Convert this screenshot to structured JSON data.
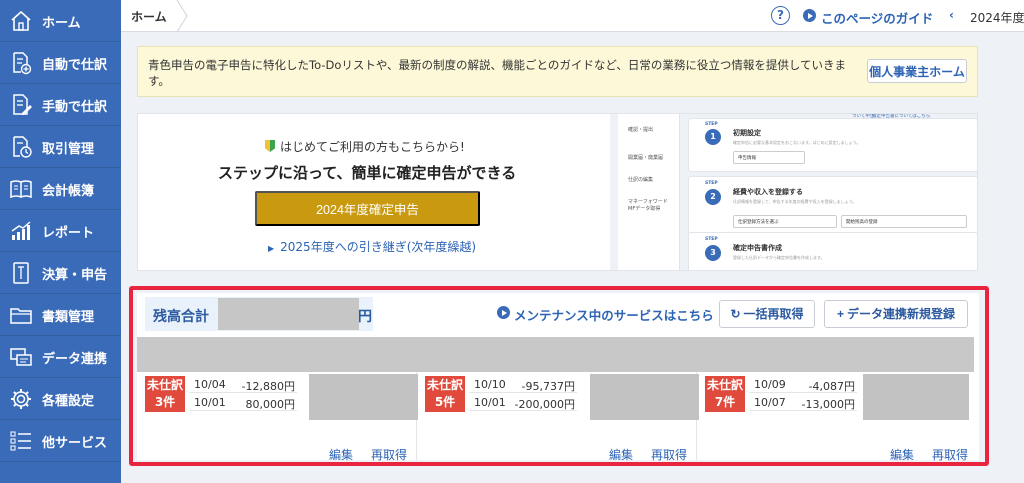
{
  "sidebar": {
    "items": [
      {
        "label": "ホーム",
        "icon": "home-icon"
      },
      {
        "label": "自動で仕訳",
        "icon": "auto-journal-icon"
      },
      {
        "label": "手動で仕訳",
        "icon": "manual-journal-icon"
      },
      {
        "label": "取引管理",
        "icon": "transaction-icon"
      },
      {
        "label": "会計帳簿",
        "icon": "ledger-icon"
      },
      {
        "label": "レポート",
        "icon": "report-icon"
      },
      {
        "label": "決算・申告",
        "icon": "tax-filing-icon"
      },
      {
        "label": "書類管理",
        "icon": "folder-icon"
      },
      {
        "label": "データ連携",
        "icon": "data-link-icon"
      },
      {
        "label": "各種設定",
        "icon": "gear-icon"
      },
      {
        "label": "他サービス",
        "icon": "list-icon"
      }
    ]
  },
  "topbar": {
    "breadcrumb": "ホーム",
    "help_label": "?",
    "guide_label": "このページのガイド",
    "year_prev": "‹",
    "year_label": "2024年度"
  },
  "notice": {
    "text": "青色申告の電子申告に特化したTo-Doリストや、最新の制度の解説、機能ごとのガイドなど、日常の業務に役立つ情報を提供していきます。",
    "button": "個人事業主ホーム"
  },
  "promo": {
    "subtitle": "はじめてご利用の方もこちらから!",
    "title": "ステップに沿って、簡単に確定申告ができる",
    "button": "2024年度確定申告",
    "link": "2025年度への引き継ぎ(次年度繰越)",
    "preview": {
      "side_items": [
        "確認・提出",
        "開業届・廃業届",
        "仕訳の編集",
        "マネーフォワード",
        "MFデータ取得"
      ],
      "header_links": [
        "ついて申告",
        "確定申告書についてはこちら"
      ],
      "steps": [
        {
          "step": "STEP",
          "num": "1",
          "title": "初期設定",
          "desc": "確定申告に必要な基本設定をおこないます。はじめに設定しましょう。",
          "buttons": [
            "申告情報"
          ]
        },
        {
          "step": "STEP",
          "num": "2",
          "title": "経費や収入を登録する",
          "desc": "仕訳情報を登録して、申告する年度の経費や収入を登録しましょう。",
          "buttons": [
            "仕訳登録方法を選ぶ",
            "開始残高の登録"
          ]
        },
        {
          "step": "STEP",
          "num": "3",
          "title": "確定申告書作成",
          "desc": "登録した仕訳データから確定申告書を作成します。",
          "buttons": []
        }
      ]
    }
  },
  "balance": {
    "label": "残高合計",
    "unit": "円",
    "maintenance": "メンテナンス中のサービスはこちら",
    "refresh_all": "一括再取得",
    "add_link": "データ連携新規登録"
  },
  "accounts": [
    {
      "badge_top": "未仕訳",
      "badge_bottom": "3件",
      "rows": [
        {
          "date": "10/04",
          "amount": "-12,880円"
        },
        {
          "date": "10/01",
          "amount": "80,000円"
        }
      ],
      "edit": "編集",
      "refetch": "再取得"
    },
    {
      "badge_top": "未仕訳",
      "badge_bottom": "5件",
      "rows": [
        {
          "date": "10/10",
          "amount": "-95,737円"
        },
        {
          "date": "10/01",
          "amount": "-200,000円"
        }
      ],
      "edit": "編集",
      "refetch": "再取得"
    },
    {
      "badge_top": "未仕訳",
      "badge_bottom": "7件",
      "rows": [
        {
          "date": "10/09",
          "amount": "-4,087円"
        },
        {
          "date": "10/07",
          "amount": "-13,000円"
        }
      ],
      "edit": "編集",
      "refetch": "再取得"
    }
  ],
  "colors": {
    "sidebar": "#3a6bb8",
    "accent_link": "#2c63b5",
    "promo_button": "#c99a10",
    "badge": "#e04a3c",
    "highlight_border": "#e8243f",
    "notice_bg": "#fdf9d8"
  }
}
